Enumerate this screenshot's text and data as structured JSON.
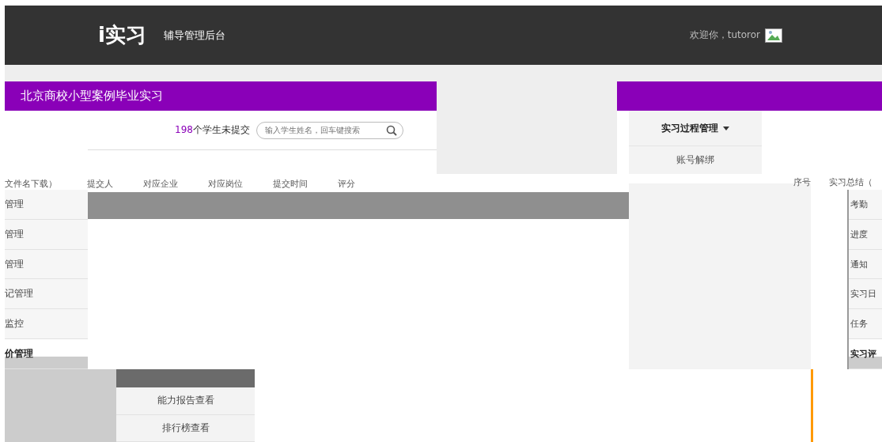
{
  "header": {
    "logo": "i实习",
    "title": "辅导管理后台",
    "welcome": "欢迎你，tutoror"
  },
  "course_title": "北京商校小型案例毕业实习",
  "pending": {
    "count": "198",
    "text": "个学生未提交"
  },
  "search": {
    "placeholder": "输入学生姓名，回车键搜索"
  },
  "process_menu": {
    "label": "实习过程管理",
    "items": [
      "账号解绑"
    ]
  },
  "table": {
    "columns": [
      "文件名下载）",
      "提交人",
      "对应企业",
      "对应岗位",
      "提交时间",
      "评分"
    ]
  },
  "right_table": {
    "columns": [
      "序号",
      "实习总结（"
    ]
  },
  "sidebar": {
    "items": [
      {
        "label": "管理",
        "expanded": false
      },
      {
        "label": "管理",
        "expanded": false
      },
      {
        "label": "管理",
        "expanded": false
      },
      {
        "label": "记管理",
        "expanded": false
      },
      {
        "label": "监控",
        "expanded": false
      },
      {
        "label": "价管理",
        "expanded": true
      }
    ]
  },
  "submenu": {
    "items": [
      "能力报告查看",
      "排行榜查看"
    ]
  },
  "right_sidebar": {
    "items": [
      {
        "label": "考勤",
        "expanded": false
      },
      {
        "label": "进度",
        "expanded": false
      },
      {
        "label": "通知",
        "expanded": false
      },
      {
        "label": "实习日",
        "expanded": false
      },
      {
        "label": "任务",
        "expanded": false
      },
      {
        "label": "实习评",
        "expanded": true
      }
    ]
  }
}
